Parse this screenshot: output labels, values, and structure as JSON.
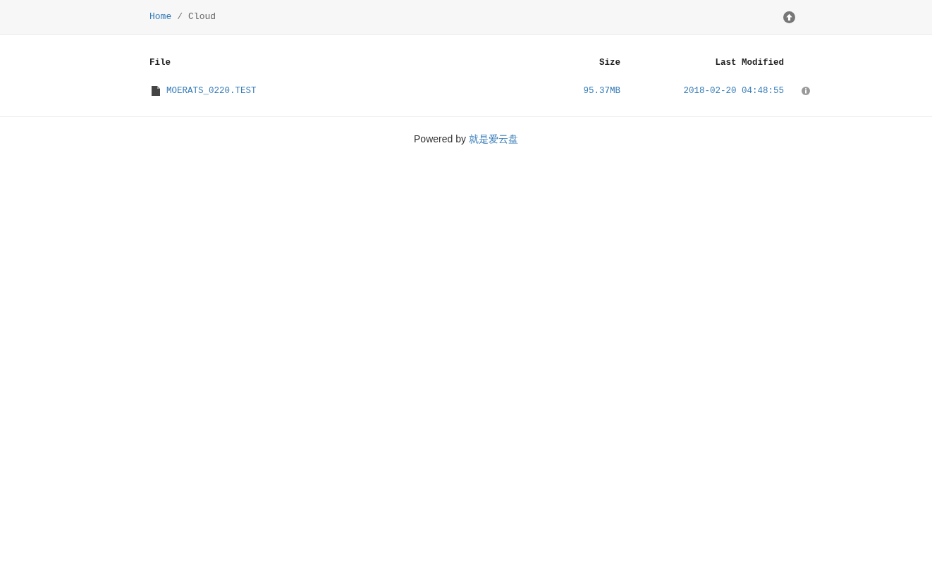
{
  "breadcrumb": {
    "items": [
      "Home",
      "Cloud"
    ],
    "separator": "/"
  },
  "table": {
    "columns": [
      "File",
      "Size",
      "Last Modified"
    ],
    "rows": [
      {
        "name": "MOERATS_0220.TEST",
        "size": "95.37MB",
        "modified": "2018-02-20 04:48:55"
      }
    ]
  },
  "footer": {
    "text": "Powered by",
    "link": "就是爱云盘"
  }
}
